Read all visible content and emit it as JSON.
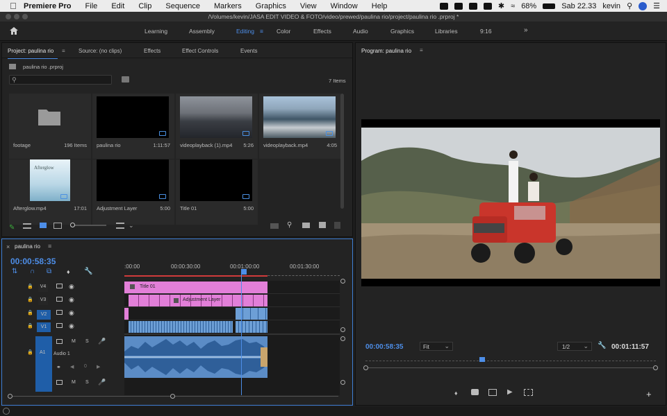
{
  "menubar": {
    "app": "Premiere Pro",
    "items": [
      "File",
      "Edit",
      "Clip",
      "Sequence",
      "Markers",
      "Graphics",
      "View",
      "Window",
      "Help"
    ],
    "battery": "68%",
    "clock": "Sab 22.33",
    "user": "kevin"
  },
  "window": {
    "title": "/Volumes/kevin/JASA EDIT VIDEO & FOTO/video/prewed/paulina rio/project/paulina rio .prproj *"
  },
  "workspaces": {
    "items": [
      "Learning",
      "Assembly",
      "Editing",
      "Color",
      "Effects",
      "Audio",
      "Graphics",
      "Libraries",
      "9:16"
    ],
    "active": "Editing"
  },
  "project": {
    "tabs": [
      "Project: paulina rio",
      "Source: (no clips)",
      "Effects",
      "Effect Controls",
      "Events"
    ],
    "file": "paulina rio .prproj",
    "search_placeholder": "",
    "item_count": "7 Items",
    "items": [
      {
        "name": "footage",
        "meta": "196 Items"
      },
      {
        "name": "paulina rio",
        "meta": "1:11:57"
      },
      {
        "name": "videoplayback (1).mp4",
        "meta": "5:26"
      },
      {
        "name": "videoplayback.mp4",
        "meta": "4:05"
      },
      {
        "name": "Afterglow.mp4",
        "meta": "17:01",
        "thumb_text": "Afterglow"
      },
      {
        "name": "Adjustment Layer",
        "meta": "5:00"
      },
      {
        "name": "Title 01",
        "meta": "5:00"
      }
    ]
  },
  "program": {
    "title": "Program: paulina rio",
    "timecode": "00:00:58:35",
    "fit": "Fit",
    "resolution": "1/2",
    "duration": "00:01:11:57"
  },
  "timeline": {
    "name": "paulina rio",
    "timecode": "00:00:58:35",
    "ruler": [
      ":00:00",
      "00:00:30:00",
      "00:01:00:00",
      "00:01:30:00"
    ],
    "tracks": [
      "V4",
      "V3",
      "V2",
      "V1",
      "A1"
    ],
    "clips": {
      "title": "Title 01",
      "adjust": "Adjustment Layer"
    },
    "audio_name": "Audio 1",
    "audio_vol": "0",
    "m": "M",
    "s": "S"
  },
  "colors": {
    "accent": "#4d8ee8",
    "title_clip": "#e27fd8",
    "video_clip": "#6d9fd6",
    "audio_clip": "#5b8cc6"
  }
}
